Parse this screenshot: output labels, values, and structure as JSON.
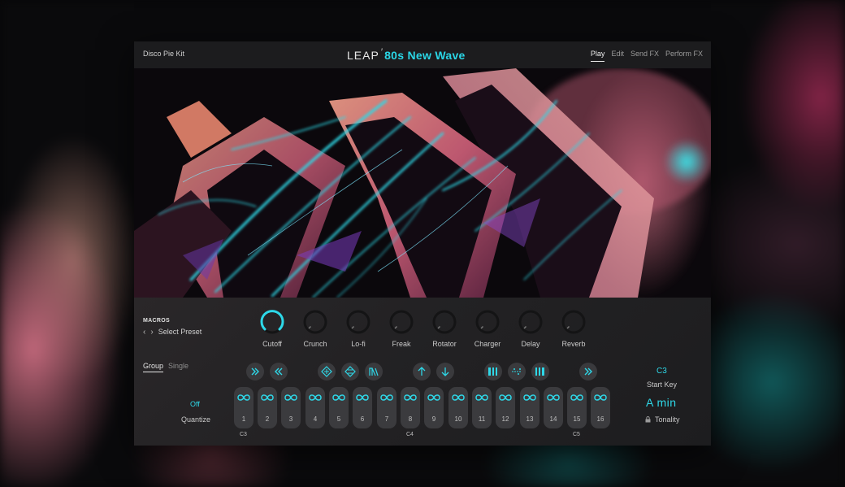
{
  "header": {
    "kit_name": "Disco Pie Kit",
    "logo_leap": "LEAP",
    "logo_title": "80s New Wave",
    "tabs": [
      {
        "label": "Play",
        "active": true
      },
      {
        "label": "Edit",
        "active": false
      },
      {
        "label": "Send FX",
        "active": false
      },
      {
        "label": "Perform FX",
        "active": false
      }
    ]
  },
  "macros": {
    "heading": "MACROS",
    "preset_label": "Select Preset",
    "knobs": [
      {
        "label": "Cutoff",
        "value": 1.0
      },
      {
        "label": "Crunch",
        "value": 0.0
      },
      {
        "label": "Lo-fi",
        "value": 0.0
      },
      {
        "label": "Freak",
        "value": 0.0
      },
      {
        "label": "Rotator",
        "value": 0.0
      },
      {
        "label": "Charger",
        "value": 0.0
      },
      {
        "label": "Delay",
        "value": 0.0
      },
      {
        "label": "Reverb",
        "value": 0.0
      }
    ]
  },
  "mode": {
    "group": "Group",
    "single": "Single",
    "selected": "Group"
  },
  "quantize": {
    "value": "Off",
    "label": "Quantize"
  },
  "pads": [
    "1",
    "2",
    "3",
    "4",
    "5",
    "6",
    "7",
    "8",
    "9",
    "10",
    "11",
    "12",
    "13",
    "14",
    "15",
    "16"
  ],
  "note_labels": [
    "C3",
    "C4",
    "C5"
  ],
  "start_key": {
    "value": "C3",
    "label": "Start Key"
  },
  "tonality": {
    "value": "A  min",
    "label": "Tonality"
  },
  "colors": {
    "accent": "#2ed8e8",
    "panel": "#1f1f21",
    "pad": "#3b3b3e"
  },
  "fx_icons": [
    "fast-forward-icon",
    "rewind-icon",
    "diamond-pattern-icon",
    "diamond-pattern-icon",
    "waveform-icon",
    "arrow-up-icon",
    "arrow-down-icon",
    "stutter-icon",
    "scatter-icon",
    "stutter-icon",
    "fast-forward-icon"
  ]
}
